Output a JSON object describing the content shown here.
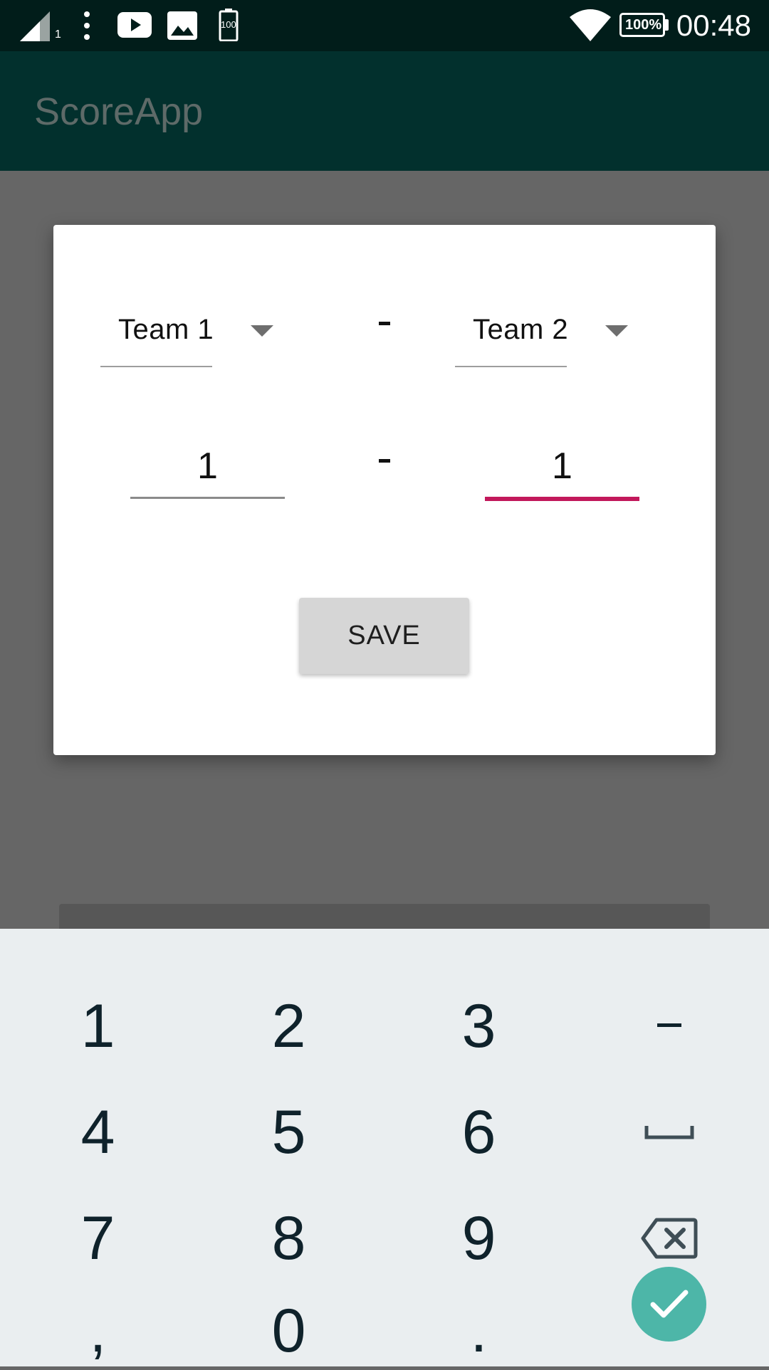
{
  "status_bar": {
    "time": "00:48",
    "battery": "100%",
    "battery_small": "100",
    "signal_sub": "1",
    "icons": [
      "signal-icon",
      "more-icon",
      "youtube-icon",
      "image-icon",
      "battery-saver-icon",
      "wifi-icon",
      "battery-icon"
    ]
  },
  "app_bar": {
    "title": "ScoreApp"
  },
  "dialog": {
    "team1_value": "Team 1",
    "team2_value": "Team 2",
    "separator_top": "-",
    "separator_bottom": "-",
    "score1_value": "1",
    "score2_value": "1",
    "save_label": "SAVE"
  },
  "colors": {
    "status_bar": "#011d1a",
    "app_bar": "#02302d",
    "focused_underline": "#c2185b",
    "enter_key": "#4db6a8"
  },
  "keyboard": {
    "rows": [
      [
        "1",
        "2",
        "3",
        "-"
      ],
      [
        "4",
        "5",
        "6",
        "space"
      ],
      [
        "7",
        "8",
        "9",
        "backspace"
      ],
      [
        ",",
        "0",
        ".",
        "done"
      ]
    ],
    "keys": {
      "k1": "1",
      "k2": "2",
      "k3": "3",
      "kminus": "-",
      "k4": "4",
      "k5": "5",
      "k6": "6",
      "k7": "7",
      "k8": "8",
      "k9": "9",
      "kcomma": ",",
      "k0": "0",
      "kdot": "."
    }
  }
}
